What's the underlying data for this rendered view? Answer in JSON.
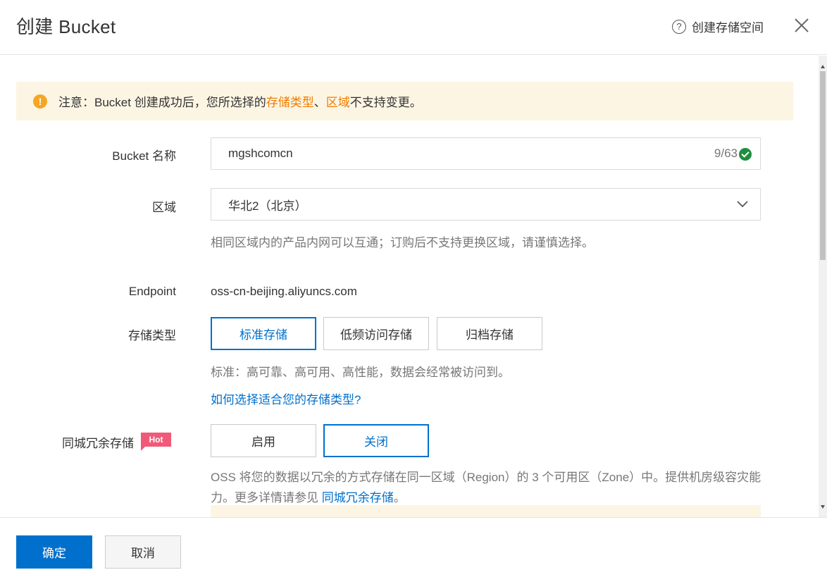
{
  "dialog": {
    "title": "创建 Bucket",
    "help_link_label": "创建存储空间",
    "close_icon": "close-icon"
  },
  "notice": {
    "prefix": "注意：Bucket 创建成功后，您所选择的 ",
    "highlight_1": "存储类型",
    "separator": "、",
    "highlight_2": "区域",
    "suffix": " 不支持变更。"
  },
  "form": {
    "bucket_name": {
      "label": "Bucket 名称",
      "value": "mgshcomcn",
      "counter": "9/63"
    },
    "region": {
      "label": "区域",
      "selected": "华北2（北京）",
      "hint": "相同区域内的产品内网可以互通；订购后不支持更换区域，请谨慎选择。"
    },
    "endpoint": {
      "label": "Endpoint",
      "value": "oss-cn-beijing.aliyuncs.com"
    },
    "storage_class": {
      "label": "存储类型",
      "options": [
        "标准存储",
        "低频访问存储",
        "归档存储"
      ],
      "selected_index": 0,
      "hint": "标准：高可靠、高可用、高性能，数据会经常被访问到。",
      "help_link": "如何选择适合您的存储类型?"
    },
    "zone_redundancy": {
      "label": "同城冗余存储",
      "badge": "Hot",
      "options": [
        "启用",
        "关闭"
      ],
      "selected_index": 1,
      "desc": "OSS 将您的数据以冗余的方式存储在同一区域（Region）的 3 个可用区（Zone）中。提供机房级容灾能力。更多详情请参见 ",
      "desc_link": "同城冗余存储",
      "desc_end": "。"
    }
  },
  "footer": {
    "confirm_label": "确定",
    "cancel_label": "取消"
  },
  "colors": {
    "primary": "#0070cc",
    "warning": "#f5a623",
    "highlight": "#f07c00",
    "success": "#1e8e3e",
    "hot_badge": "#f05a78"
  }
}
